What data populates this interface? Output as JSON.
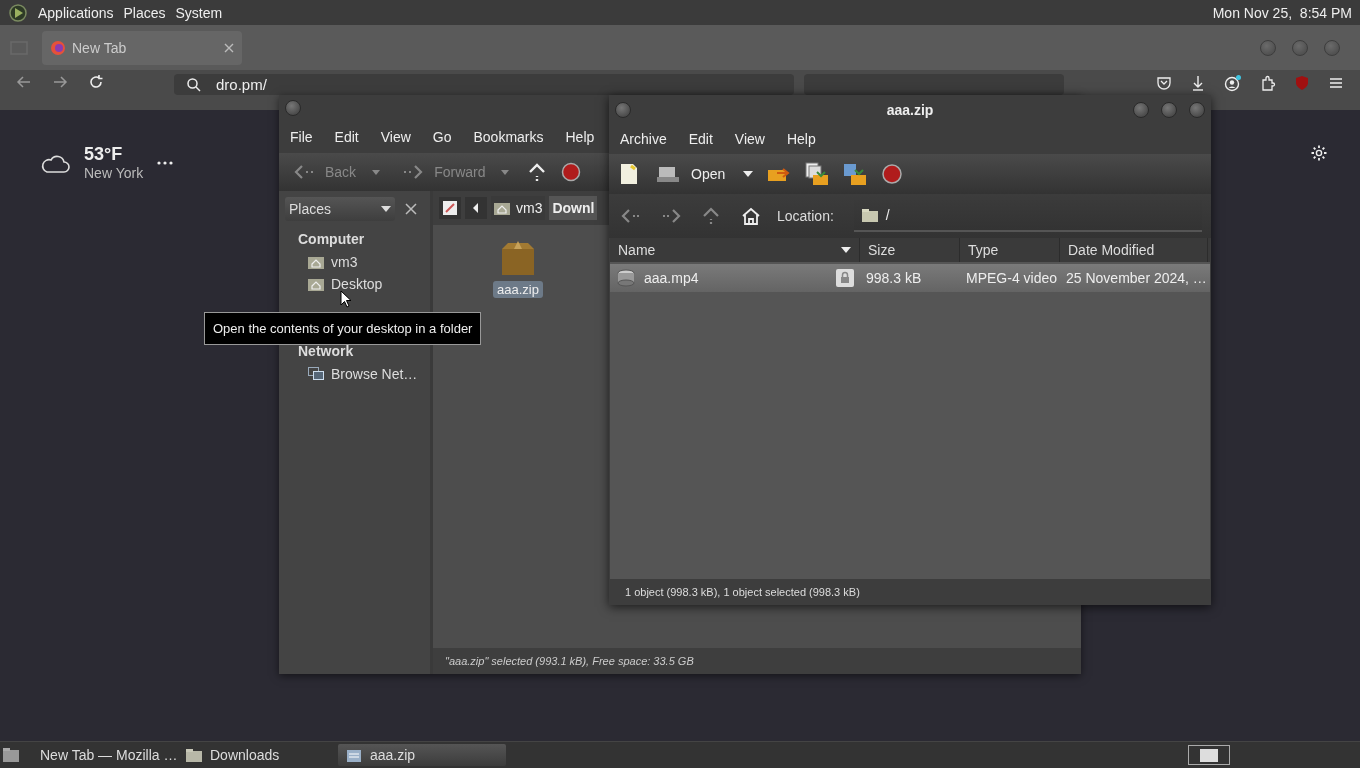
{
  "top_panel": {
    "menus": [
      "Applications",
      "Places",
      "System"
    ],
    "clock": "Mon Nov 25,  8:54 PM"
  },
  "browser": {
    "tabs": [
      {
        "title": "New Tab",
        "selected": true
      }
    ],
    "address": "dro.pm/",
    "weather": {
      "temperature": "53°F",
      "location": "New York"
    }
  },
  "file_manager": {
    "menus": [
      "File",
      "Edit",
      "View",
      "Go",
      "Bookmarks",
      "Help"
    ],
    "toolbar": [
      {
        "label": "Back",
        "disabled": true
      },
      {
        "label": "Forward",
        "disabled": true
      }
    ],
    "places_selector": "Places",
    "breadcrumbs": [
      {
        "label": "vm3",
        "selected": false
      },
      {
        "label": "Downl",
        "selected": true
      }
    ],
    "sidebar": [
      {
        "heading": "Computer",
        "items": [
          {
            "label": "vm3",
            "kind": "home"
          },
          {
            "label": "Desktop",
            "kind": "home"
          }
        ]
      },
      {
        "heading": "Network",
        "items": [
          {
            "label": "Browse Net…",
            "kind": "network"
          }
        ]
      }
    ],
    "files": [
      {
        "name": "aaa.zip",
        "selected": true
      }
    ],
    "status": "\"aaa.zip\" selected (993.1 kB), Free space: 33.5 GB"
  },
  "tooltip": "Open the contents of your desktop in a folder",
  "archive": {
    "title": "aaa.zip",
    "menus": [
      "Archive",
      "Edit",
      "View",
      "Help"
    ],
    "open_label": "Open",
    "location_label": "Location:",
    "location": "/",
    "columns": [
      "Name",
      "Size",
      "Type",
      "Date Modified"
    ],
    "rows": [
      {
        "name": "aaa.mp4",
        "size": "998.3 kB",
        "type": "MPEG-4 video",
        "date": "25 November 2024, …",
        "selected": true
      }
    ],
    "status": "1 object (998.3 kB), 1 object selected (998.3 kB)"
  },
  "taskbar": [
    {
      "label": "New Tab — Mozilla …",
      "kind": "browser",
      "selected": false
    },
    {
      "label": "Downloads",
      "kind": "folder",
      "selected": false
    },
    {
      "label": "aaa.zip",
      "kind": "archive",
      "selected": true
    }
  ]
}
